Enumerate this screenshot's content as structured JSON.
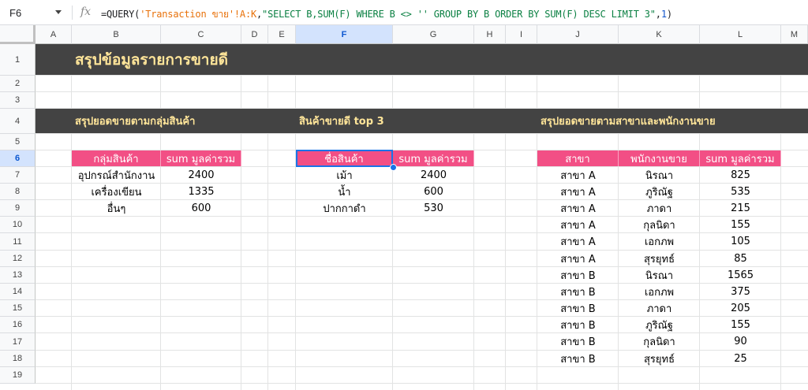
{
  "name_box": "F6",
  "formula": {
    "prefix": "=QUERY(",
    "ref": "'Transaction ขาย'!A:K",
    "comma1": ",",
    "query": "\"SELECT B,SUM(F) WHERE B <> '' GROUP BY B ORDER BY SUM(F) DESC LIMIT 3\"",
    "comma2": ",",
    "headers": "1",
    "suffix": ")"
  },
  "fx_icon": "fx-icon",
  "columns": [
    "A",
    "B",
    "C",
    "D",
    "E",
    "F",
    "G",
    "H",
    "I",
    "J",
    "K",
    "L",
    "M"
  ],
  "rows": [
    "1",
    "2",
    "3",
    "4",
    "5",
    "6",
    "7",
    "8",
    "9",
    "10",
    "11",
    "12",
    "13",
    "14",
    "15",
    "16",
    "17",
    "18",
    "19"
  ],
  "selected_column": "F",
  "selected_row": "6",
  "title": "สรุปข้อมูลรายการขายดี",
  "sections": {
    "category": "สรุปยอดขายตามกลุ่มสินค้า",
    "top3": "สินค้าขายดี top 3",
    "branch": "สรุปยอดขายตามสาขาและพนักงานขาย"
  },
  "category_table": {
    "headers": [
      "กลุ่มสินค้า",
      "sum มูลค่ารวม"
    ],
    "rows": [
      [
        "อุปกรณ์สำนักงาน",
        "2400"
      ],
      [
        "เครื่องเขียน",
        "1335"
      ],
      [
        "อื่นๆ",
        "600"
      ]
    ]
  },
  "top3_table": {
    "headers": [
      "ชื่อสินค้า",
      "sum มูลค่ารวม"
    ],
    "rows": [
      [
        "เม้า",
        "2400"
      ],
      [
        "น้ำ",
        "600"
      ],
      [
        "ปากกาดำ",
        "530"
      ]
    ]
  },
  "branch_table": {
    "headers": [
      "สาขา",
      "พนักงานขาย",
      "sum มูลค่ารวม"
    ],
    "rows": [
      [
        "สาขา A",
        "นิรณา",
        "825"
      ],
      [
        "สาขา A",
        "ภูริณัฐ",
        "535"
      ],
      [
        "สาขา A",
        "ภาดา",
        "215"
      ],
      [
        "สาขา A",
        "กุลนิดา",
        "155"
      ],
      [
        "สาขา A",
        "เอกภพ",
        "105"
      ],
      [
        "สาขา A",
        "สุรยุทธ์",
        "85"
      ],
      [
        "สาขา B",
        "นิรณา",
        "1565"
      ],
      [
        "สาขา B",
        "เอกภพ",
        "375"
      ],
      [
        "สาขา B",
        "ภาดา",
        "205"
      ],
      [
        "สาขา B",
        "ภูริณัฐ",
        "155"
      ],
      [
        "สาขา B",
        "กุลนิดา",
        "90"
      ],
      [
        "สาขา B",
        "สุรยุทธ์",
        "25"
      ]
    ]
  },
  "colors": {
    "band": "#434343",
    "band_text": "#ffe599",
    "header_fill": "#f24f85",
    "selection": "#1a73e8"
  }
}
